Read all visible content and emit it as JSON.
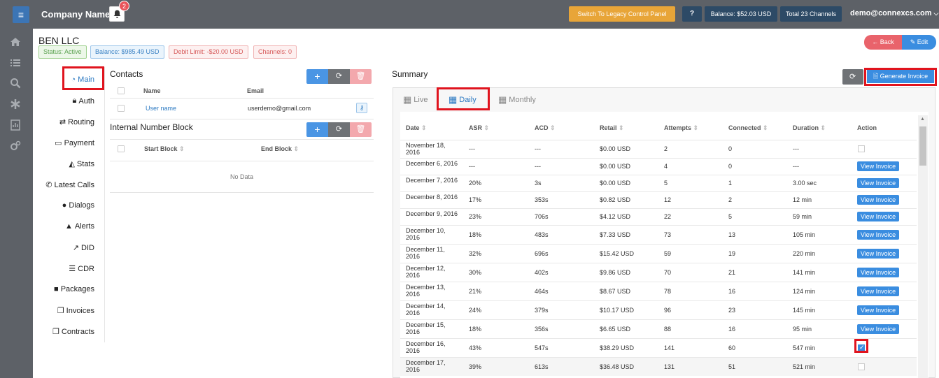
{
  "header": {
    "company_name": "Company Name",
    "notification_count": "2",
    "legacy_button": "Switch To Legacy Control Panel",
    "help_label": "?",
    "balance": "Balance: $52.03 USD",
    "channels": "Total 23 Channels",
    "user_email": "demo@connexcs.com"
  },
  "account": {
    "name": "BEN LLC",
    "status": "Status: Active",
    "balance": "Balance: $985.49 USD",
    "debit_limit": "Debit Limit: -$20.00 USD",
    "channels": "Channels: 0",
    "back_label": "Back",
    "edit_label": "Edit"
  },
  "nav": {
    "items": [
      "Main",
      "Auth",
      "Routing",
      "Payment",
      "Stats",
      "Latest Calls",
      "Dialogs",
      "Alerts",
      "DID",
      "CDR",
      "Packages",
      "Invoices",
      "Contracts"
    ]
  },
  "contacts": {
    "title": "Contacts",
    "col_name": "Name",
    "col_email": "Email",
    "row_name": "User name",
    "row_email": "userdemo@gmail.com"
  },
  "number_block": {
    "title": "Internal Number Block",
    "col_start": "Start Block",
    "col_end": "End Block",
    "empty": "No Data"
  },
  "summary": {
    "title": "Summary",
    "generate_invoice": "Generate Invoice",
    "tabs": [
      "Live",
      "Daily",
      "Monthly"
    ],
    "active_tab": "Daily",
    "columns": [
      "Date",
      "ASR",
      "ACD",
      "Retail",
      "Attempts",
      "Connected",
      "Duration",
      "Action"
    ],
    "view_invoice_label": "View Invoice",
    "rows": [
      {
        "date": "November 18, 2016",
        "asr": "---",
        "acd": "---",
        "retail": "$0.00 USD",
        "attempts": "2",
        "connected": "0",
        "duration": "---",
        "action": "checkbox"
      },
      {
        "date": "December 6, 2016",
        "asr": "---",
        "acd": "---",
        "retail": "$0.00 USD",
        "attempts": "4",
        "connected": "0",
        "duration": "---",
        "action": "view"
      },
      {
        "date": "December 7, 2016",
        "asr": "20%",
        "acd": "3s",
        "retail": "$0.00 USD",
        "attempts": "5",
        "connected": "1",
        "duration": "3.00 sec",
        "action": "view"
      },
      {
        "date": "December 8, 2016",
        "asr": "17%",
        "acd": "353s",
        "retail": "$0.82 USD",
        "attempts": "12",
        "connected": "2",
        "duration": "12 min",
        "action": "view"
      },
      {
        "date": "December 9, 2016",
        "asr": "23%",
        "acd": "706s",
        "retail": "$4.12 USD",
        "attempts": "22",
        "connected": "5",
        "duration": "59 min",
        "action": "view"
      },
      {
        "date": "December 10, 2016",
        "asr": "18%",
        "acd": "483s",
        "retail": "$7.33 USD",
        "attempts": "73",
        "connected": "13",
        "duration": "105 min",
        "action": "view"
      },
      {
        "date": "December 11, 2016",
        "asr": "32%",
        "acd": "696s",
        "retail": "$15.42 USD",
        "attempts": "59",
        "connected": "19",
        "duration": "220 min",
        "action": "view"
      },
      {
        "date": "December 12, 2016",
        "asr": "30%",
        "acd": "402s",
        "retail": "$9.86 USD",
        "attempts": "70",
        "connected": "21",
        "duration": "141 min",
        "action": "view"
      },
      {
        "date": "December 13, 2016",
        "asr": "21%",
        "acd": "464s",
        "retail": "$8.67 USD",
        "attempts": "78",
        "connected": "16",
        "duration": "124 min",
        "action": "view"
      },
      {
        "date": "December 14, 2016",
        "asr": "24%",
        "acd": "379s",
        "retail": "$10.17 USD",
        "attempts": "96",
        "connected": "23",
        "duration": "145 min",
        "action": "view"
      },
      {
        "date": "December 15, 2016",
        "asr": "18%",
        "acd": "356s",
        "retail": "$6.65 USD",
        "attempts": "88",
        "connected": "16",
        "duration": "95 min",
        "action": "view"
      },
      {
        "date": "December 16, 2016",
        "asr": "43%",
        "acd": "547s",
        "retail": "$38.29 USD",
        "attempts": "141",
        "connected": "60",
        "duration": "547 min",
        "action": "checkbox-checked"
      },
      {
        "date": "December 17, 2016",
        "asr": "39%",
        "acd": "613s",
        "retail": "$36.48 USD",
        "attempts": "131",
        "connected": "51",
        "duration": "521 min",
        "action": "checkbox"
      }
    ]
  },
  "colors": {
    "topbar": "#5d6167",
    "primary": "#3a8de0",
    "highlight": "#e0141e",
    "warning": "#e8a538"
  }
}
